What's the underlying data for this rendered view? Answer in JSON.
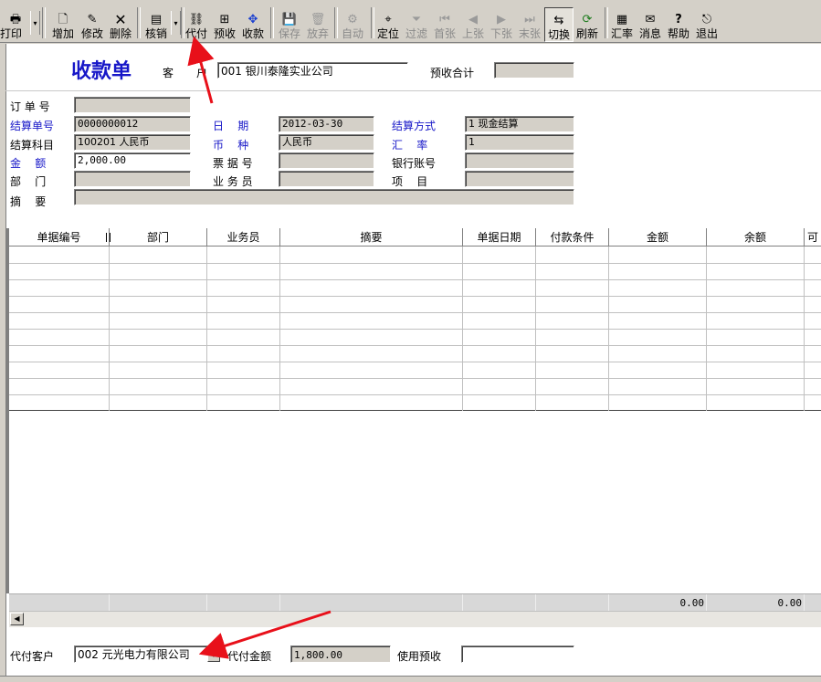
{
  "toolbar": {
    "print": "打印",
    "add": "增加",
    "modify": "修改",
    "delete": "删除",
    "writeoff": "核销",
    "daifu": "代付",
    "prepay": "预收",
    "receive": "收款",
    "save": "保存",
    "discard": "放弃",
    "auto": "自动",
    "locate": "定位",
    "filter": "过滤",
    "first": "首张",
    "prev": "上张",
    "next": "下张",
    "last": "末张",
    "switch": "切换",
    "refresh": "刷新",
    "rate": "汇率",
    "message": "消息",
    "help": "帮助",
    "exit": "退出"
  },
  "form": {
    "title": "收款单",
    "customer_label": "客",
    "customer_label2": "户",
    "customer_value": "001  银川泰隆实业公司",
    "prepay_total_label": "预收合计",
    "prepay_total_value": "",
    "order_no_label": "订 单 号",
    "order_no_value": "",
    "settle_no_label": "结算单号",
    "settle_no_value": "0000000012",
    "date_label": "日    期",
    "date_value": "2012-03-30",
    "settle_method_label": "结算方式",
    "settle_method_value": "1  现金结算",
    "settle_subject_label": "结算科目",
    "settle_subject_value": "100201  人民币",
    "currency_label": "币    种",
    "currency_value": "人民币",
    "exchange_label": "汇    率",
    "exchange_value": "1",
    "amount_label": "金    额",
    "amount_value": "2,000.00",
    "bill_no_label": "票 据 号",
    "bill_no_value": "",
    "bank_account_label": "银行账号",
    "bank_account_value": "",
    "dept_label": "部    门",
    "dept_value": "",
    "salesman_label": "业 务 员",
    "salesman_value": "",
    "project_label": "项    目",
    "project_value": "",
    "summary_label": "摘    要",
    "summary_value": ""
  },
  "grid": {
    "columns": [
      "单据编号",
      "部门",
      "业务员",
      "摘要",
      "单据日期",
      "付款条件",
      "金额",
      "余额",
      "可"
    ],
    "total_amount": "0.00",
    "total_balance": "0.00"
  },
  "footer": {
    "daifu_customer_label": "代付客户",
    "daifu_customer_value": "002  元光电力有限公司",
    "daifu_amount_label": "代付金额",
    "daifu_amount_value": "1,800.00",
    "use_prepay_label": "使用预收",
    "use_prepay_value": ""
  },
  "colors": {
    "title_blue": "#1717c8",
    "arrow_red": "#e8101a",
    "face": "#d4d0c8"
  }
}
